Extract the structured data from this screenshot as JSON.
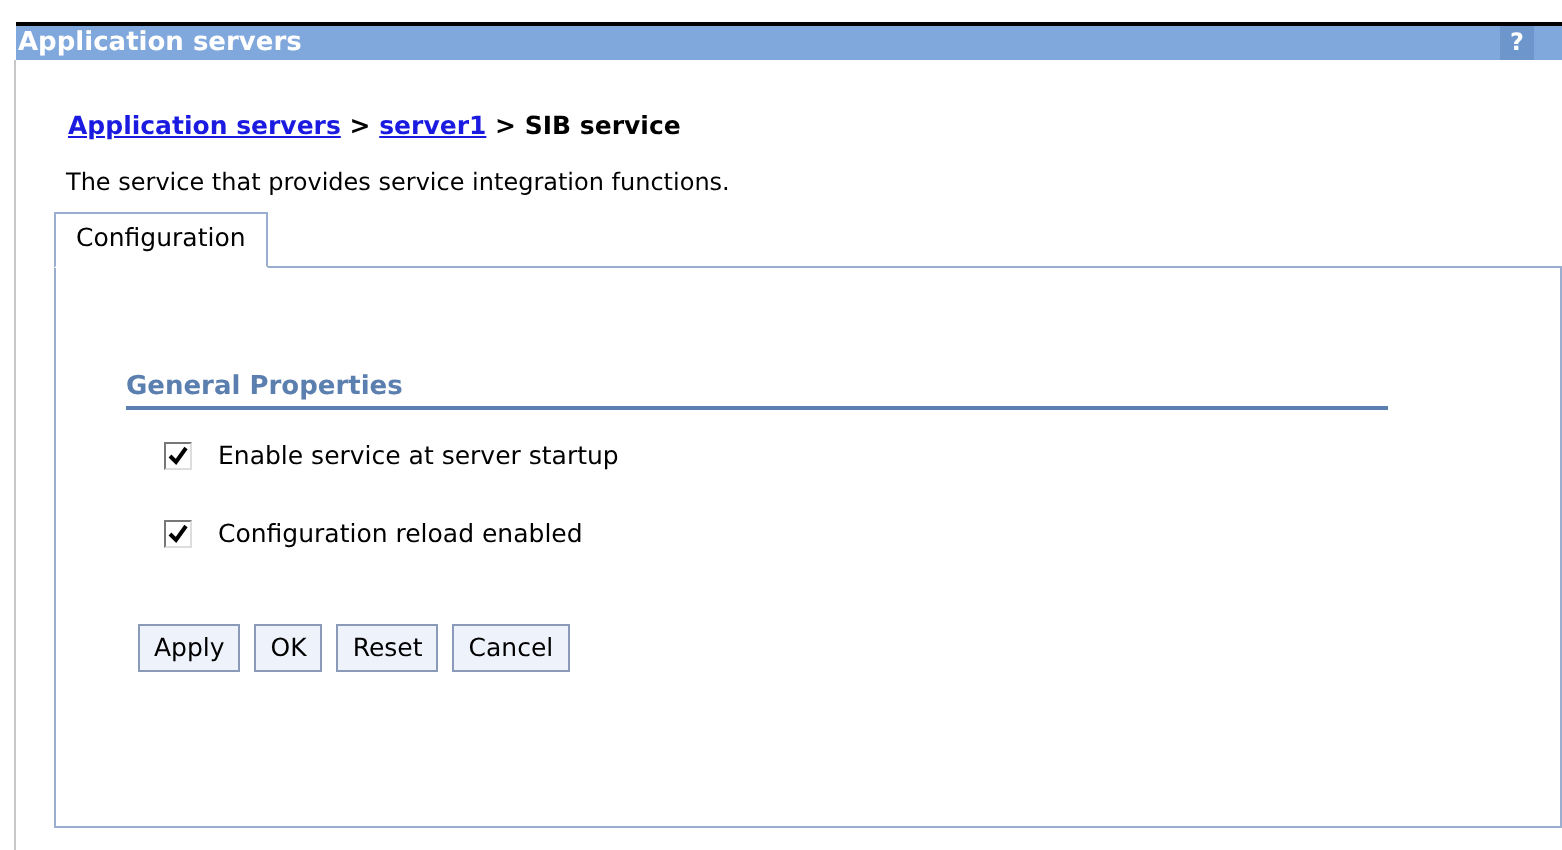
{
  "window": {
    "title": "Application servers",
    "help": "?"
  },
  "breadcrumb": [
    {
      "label": "Application servers",
      "kind": "link"
    },
    {
      "label": ">",
      "kind": "separator"
    },
    {
      "label": "server1",
      "kind": "link"
    },
    {
      "label": ">",
      "kind": "separator"
    },
    {
      "label": "SIB service",
      "kind": "current"
    }
  ],
  "description": "The service that provides service integration functions.",
  "tabs": [
    {
      "label": "Configuration",
      "selected": true
    }
  ],
  "section": {
    "title": "General Properties"
  },
  "checkboxes": [
    {
      "label": "Enable service at server startup",
      "checked": true
    },
    {
      "label": "Configuration reload enabled",
      "checked": true
    }
  ],
  "buttons": [
    "Apply",
    "OK",
    "Reset",
    "Cancel"
  ]
}
